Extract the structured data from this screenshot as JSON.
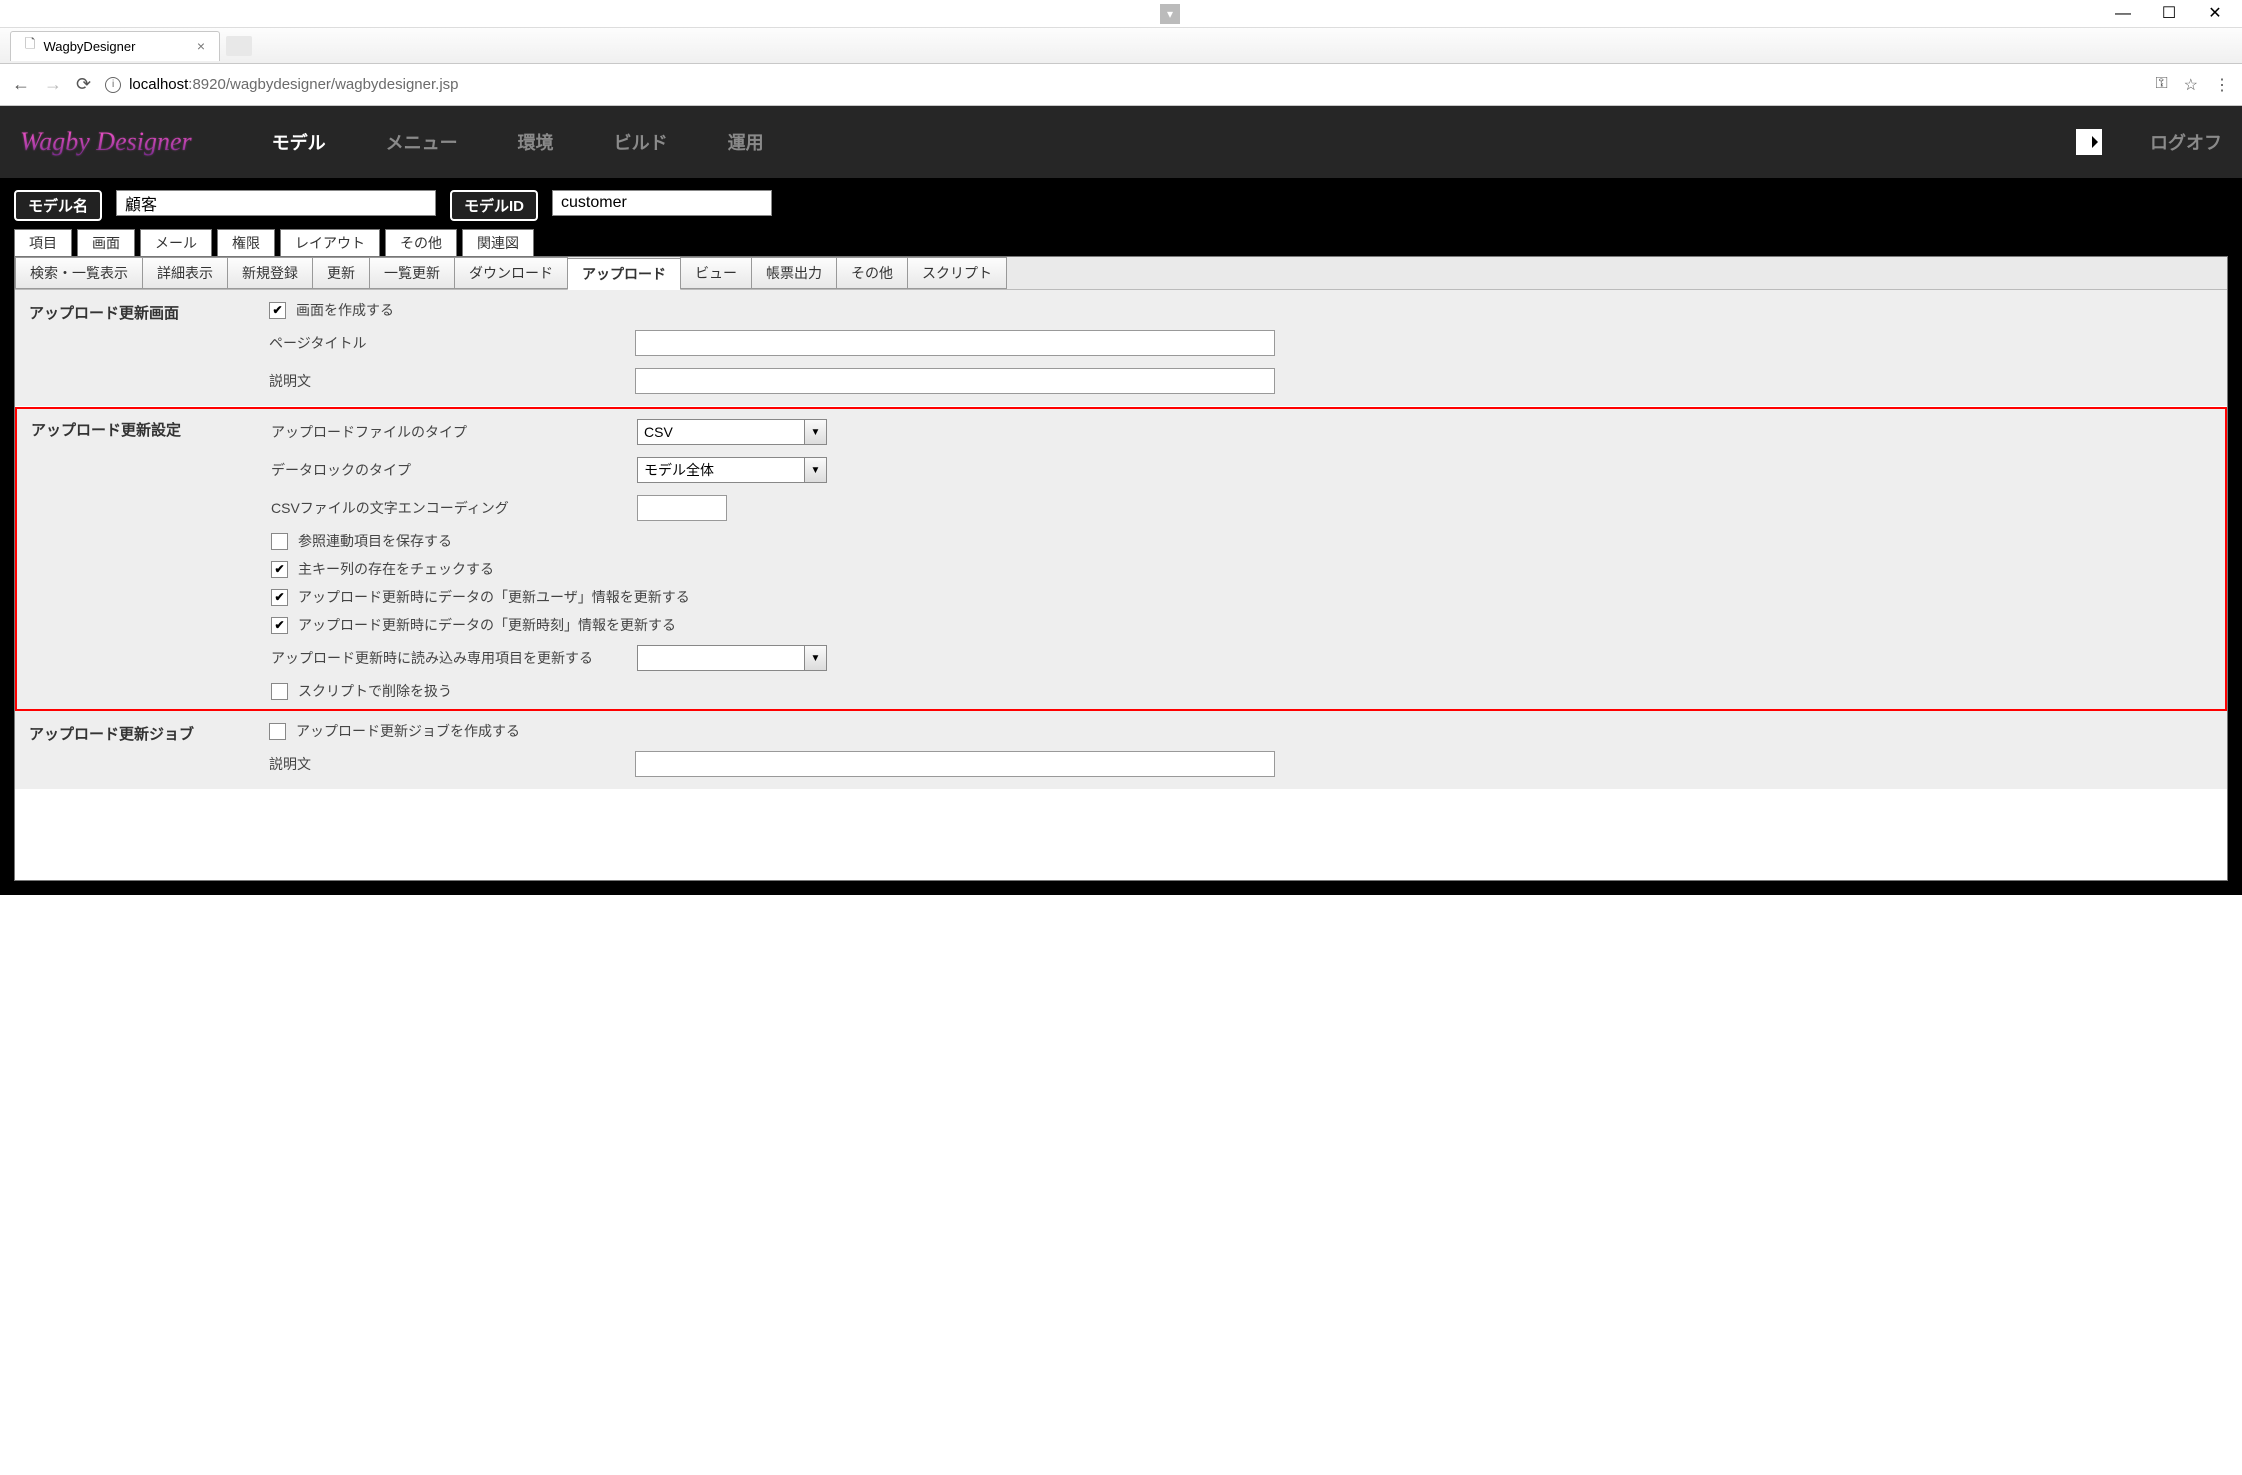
{
  "window": {
    "min": "—",
    "max": "☐",
    "close": "✕"
  },
  "browser": {
    "tab_title": "WagbyDesigner",
    "url_host": "localhost",
    "url_port": ":8920",
    "url_path": "/wagbydesigner/wagbydesigner.jsp"
  },
  "header": {
    "logo": "Wagby Designer",
    "nav": [
      "モデル",
      "メニュー",
      "環境",
      "ビルド",
      "運用"
    ],
    "logoff": "ログオフ"
  },
  "model": {
    "name_label": "モデル名",
    "name_value": "顧客",
    "id_label": "モデルID",
    "id_value": "customer"
  },
  "tabs1": [
    "項目",
    "画面",
    "メール",
    "権限",
    "レイアウト",
    "その他",
    "関連図"
  ],
  "tabs2": [
    "検索・一覧表示",
    "詳細表示",
    "新規登録",
    "更新",
    "一覧更新",
    "ダウンロード",
    "アップロード",
    "ビュー",
    "帳票出力",
    "その他",
    "スクリプト"
  ],
  "section1": {
    "title": "アップロード更新画面",
    "create_screen_label": "画面を作成する",
    "page_title_label": "ページタイトル",
    "desc_label": "説明文"
  },
  "section2": {
    "title": "アップロード更新設定",
    "file_type_label": "アップロードファイルのタイプ",
    "file_type_value": "CSV",
    "lock_type_label": "データロックのタイプ",
    "lock_type_value": "モデル全体",
    "encoding_label": "CSVファイルの文字エンコーディング",
    "save_ref_label": "参照連動項目を保存する",
    "check_pk_label": "主キー列の存在をチェックする",
    "update_user_label": "アップロード更新時にデータの「更新ユーザ」情報を更新する",
    "update_time_label": "アップロード更新時にデータの「更新時刻」情報を更新する",
    "readonly_update_label": "アップロード更新時に読み込み専用項目を更新する",
    "delete_script_label": "スクリプトで削除を扱う"
  },
  "section3": {
    "title": "アップロード更新ジョブ",
    "create_job_label": "アップロード更新ジョブを作成する",
    "desc_label": "説明文"
  }
}
